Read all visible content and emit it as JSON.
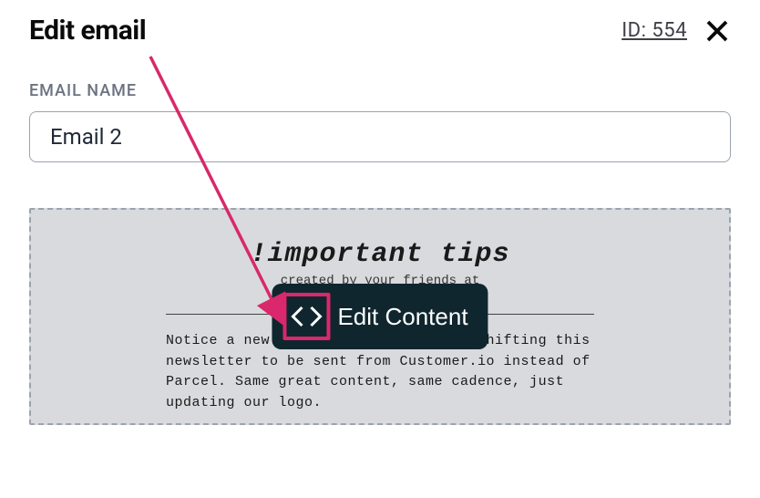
{
  "header": {
    "title": "Edit email",
    "id_label": "ID: 554"
  },
  "field": {
    "label": "EMAIL NAME",
    "value": "Email 2"
  },
  "preview": {
    "title": "!important tips",
    "subtitle_visible": "created by your friends at",
    "body": "Notice a new face about town? We're shifting this newsletter to be sent from Customer.io instead of Parcel. Same great content, same cadence, just updating our logo."
  },
  "actions": {
    "edit_content_label": "Edit Content"
  },
  "colors": {
    "annotation": "#d9286b",
    "button_bg": "#10262e"
  }
}
